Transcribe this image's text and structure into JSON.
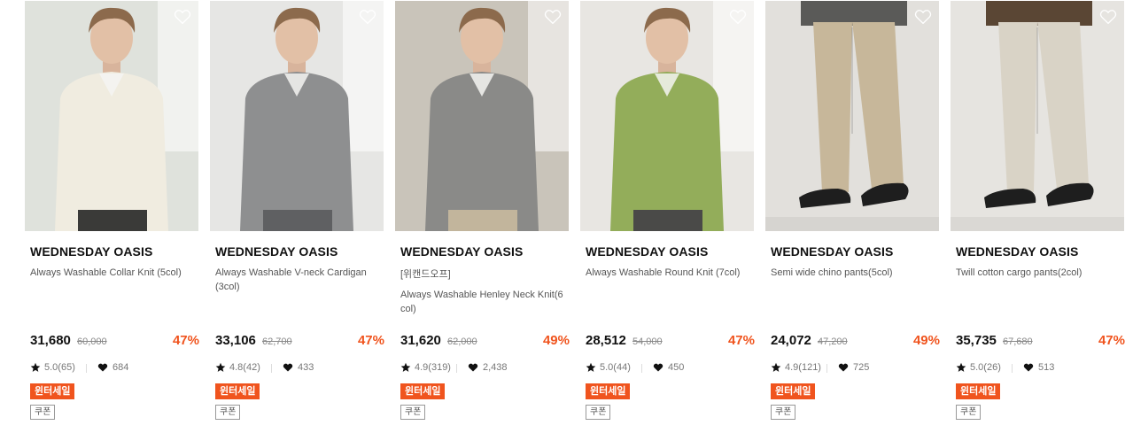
{
  "products": [
    {
      "brand": "WEDNESDAY OASIS",
      "tagline": "",
      "name": "Always Washable Collar Knit (5col)",
      "price": "31,680",
      "original_price": "60,000",
      "discount": "47%",
      "rating": "5.0(65)",
      "likes": "684",
      "sale_badge": "윈터세일",
      "coupon_badge": "쿠폰",
      "colors": {
        "bg": "#dfe2dc",
        "top": "#f0ece0",
        "bottom": "#3a3a38"
      }
    },
    {
      "brand": "WEDNESDAY OASIS",
      "tagline": "",
      "name": "Always Washable V-neck Cardigan (3col)",
      "price": "33,106",
      "original_price": "62,700",
      "discount": "47%",
      "rating": "4.8(42)",
      "likes": "433",
      "sale_badge": "윈터세일",
      "coupon_badge": "쿠폰",
      "colors": {
        "bg": "#e6e6e4",
        "top": "#8e8f90",
        "bottom": "#5f6062"
      }
    },
    {
      "brand": "WEDNESDAY OASIS",
      "tagline": "[위캔드오프]",
      "name": "Always Washable Henley Neck Knit(6col)",
      "price": "31,620",
      "original_price": "62,000",
      "discount": "49%",
      "rating": "4.9(319)",
      "likes": "2,438",
      "sale_badge": "윈터세일",
      "coupon_badge": "쿠폰",
      "colors": {
        "bg": "#c9c4ba",
        "top": "#8a8a88",
        "bottom": "#c2b59c"
      }
    },
    {
      "brand": "WEDNESDAY OASIS",
      "tagline": "",
      "name": "Always Washable Round Knit (7col)",
      "price": "28,512",
      "original_price": "54,000",
      "discount": "47%",
      "rating": "5.0(44)",
      "likes": "450",
      "sale_badge": "윈터세일",
      "coupon_badge": "쿠폰",
      "colors": {
        "bg": "#e8e6e2",
        "top": "#93ad5a",
        "bottom": "#4a4a48"
      }
    },
    {
      "brand": "WEDNESDAY OASIS",
      "tagline": "",
      "name": "Semi wide chino pants(5col)",
      "price": "24,072",
      "original_price": "47,200",
      "discount": "49%",
      "rating": "4.9(121)",
      "likes": "725",
      "sale_badge": "윈터세일",
      "coupon_badge": "쿠폰",
      "colors": {
        "bg": "#e2e0dc",
        "top": "#5a5a58",
        "bottom": "#c7b79a"
      }
    },
    {
      "brand": "WEDNESDAY OASIS",
      "tagline": "",
      "name": "Twill cotton cargo pants(2col)",
      "price": "35,735",
      "original_price": "67,680",
      "discount": "47%",
      "rating": "5.0(26)",
      "likes": "513",
      "sale_badge": "윈터세일",
      "coupon_badge": "쿠폰",
      "colors": {
        "bg": "#e6e4e0",
        "top": "#5a4634",
        "bottom": "#d9d3c6"
      }
    }
  ],
  "icons": {
    "wishlist": "heart-outline-icon",
    "rating": "star-icon",
    "likes": "heart-filled-icon"
  }
}
